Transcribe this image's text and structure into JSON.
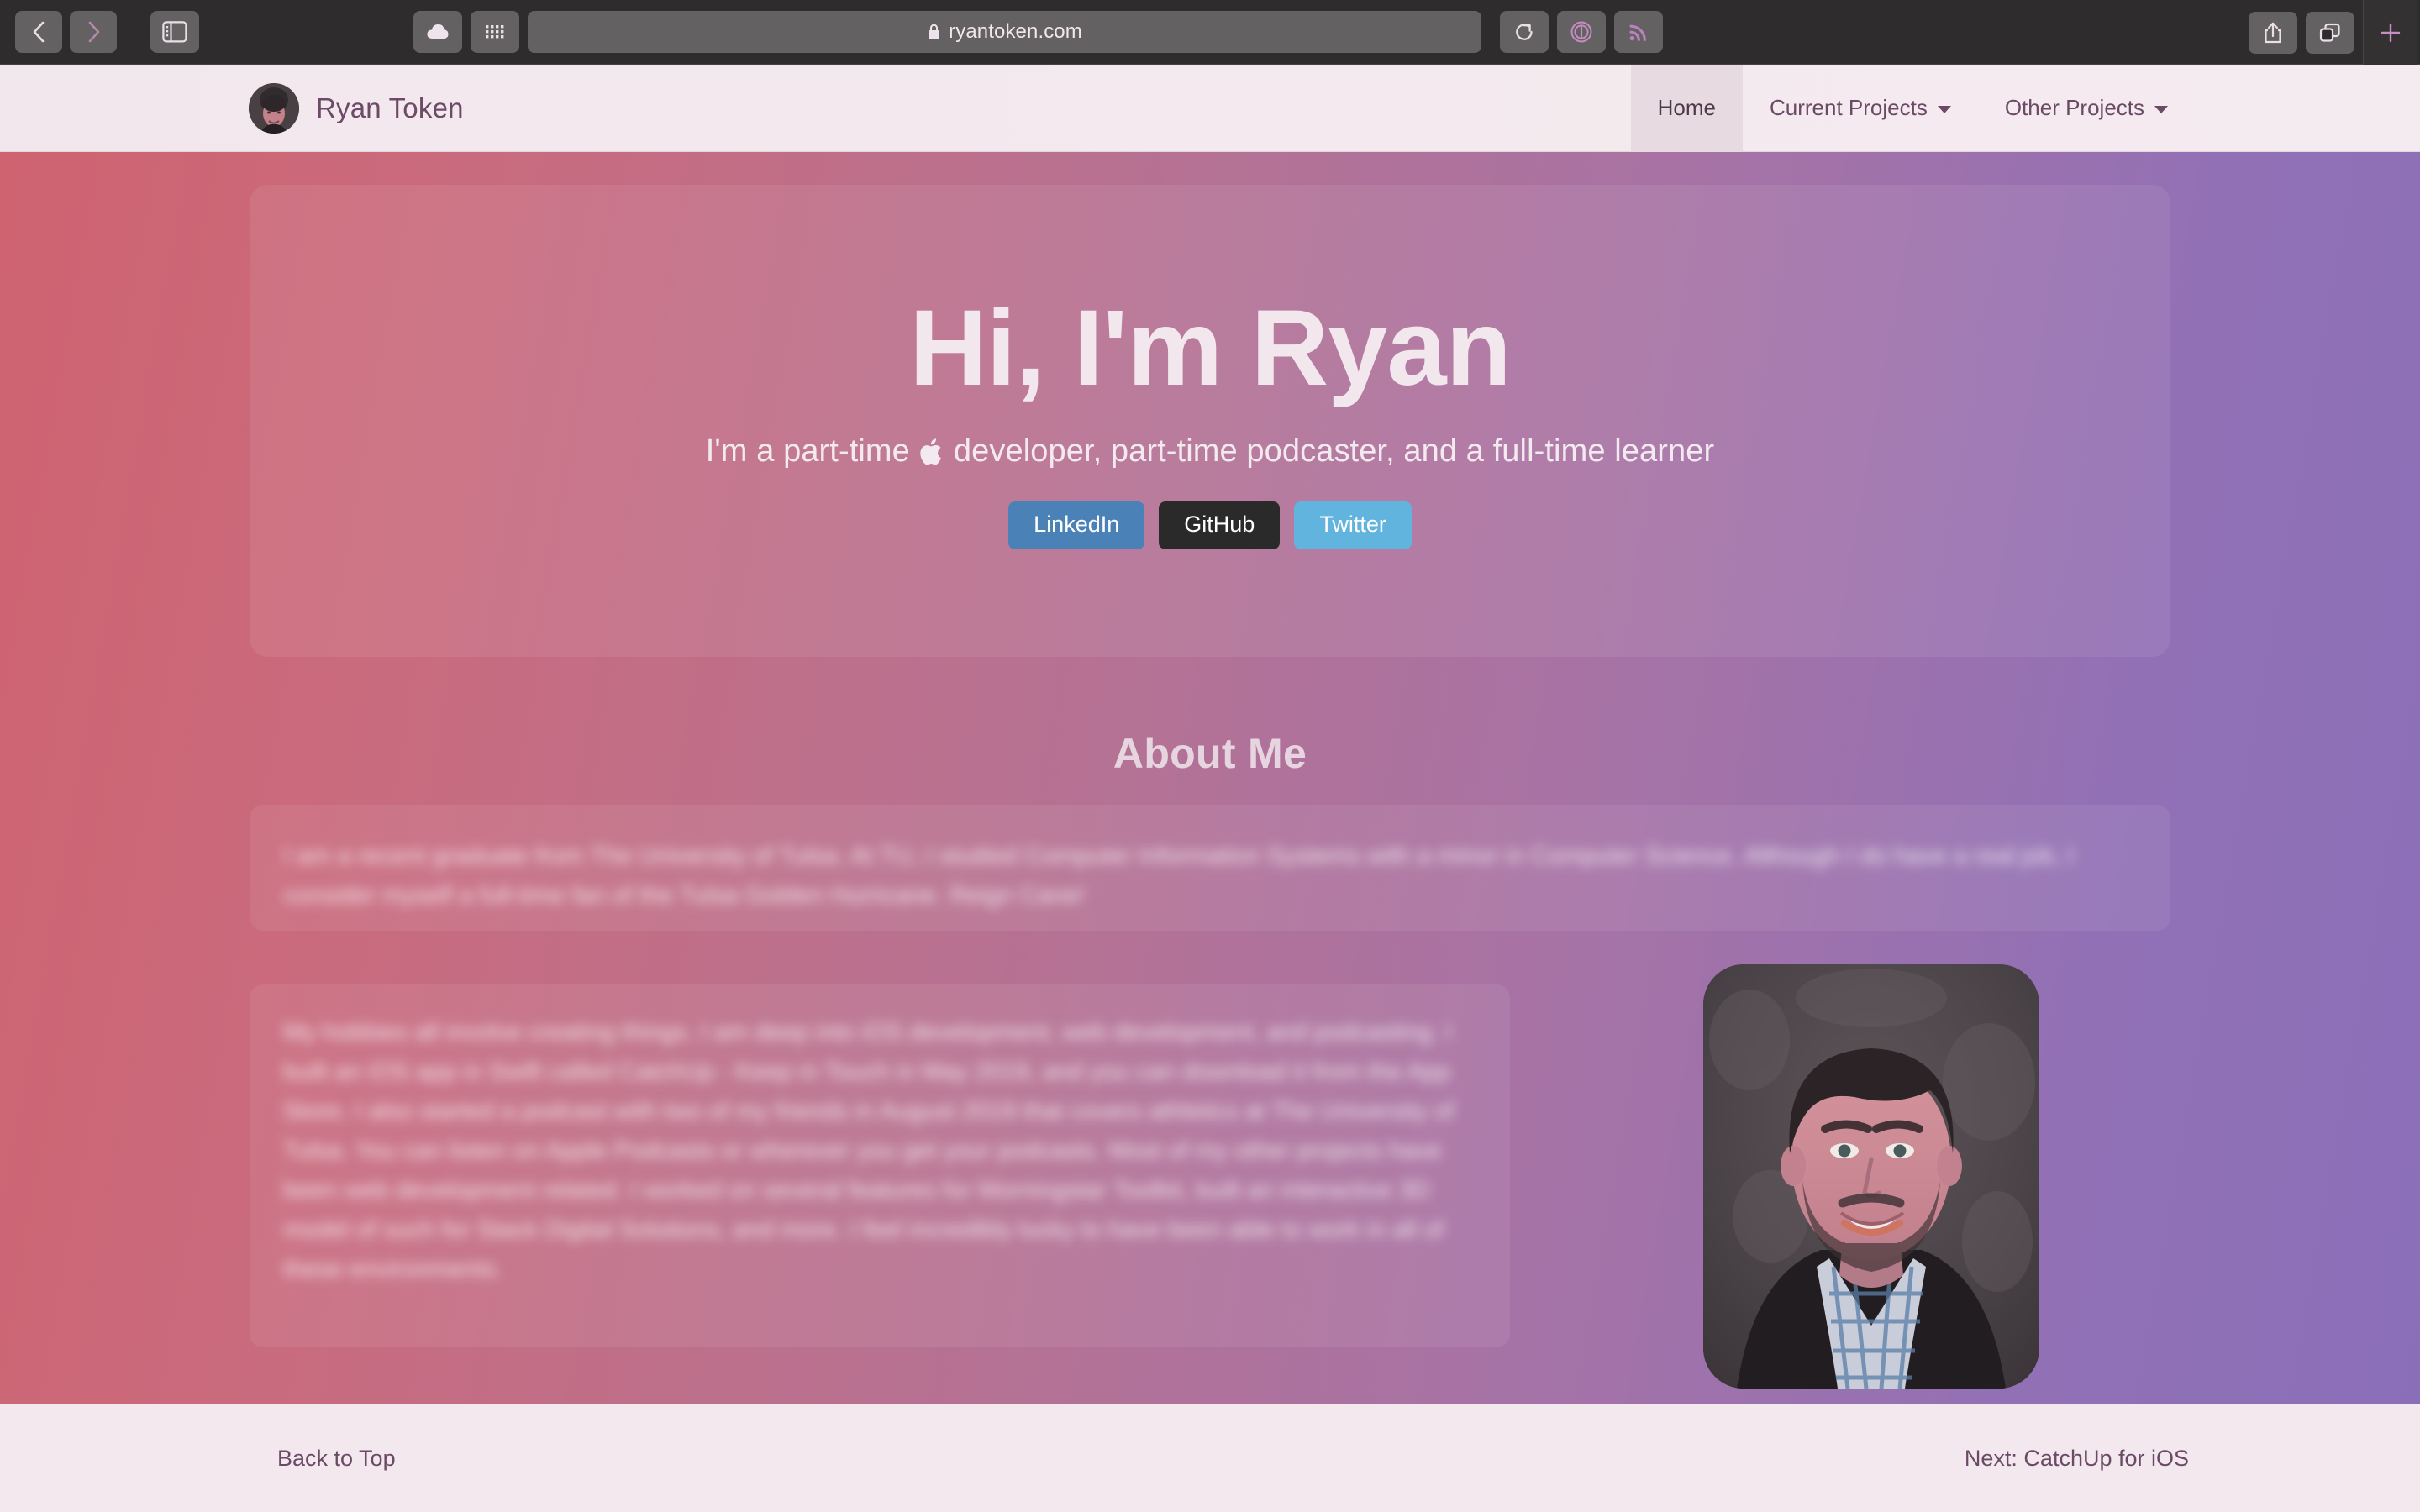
{
  "browser": {
    "url": "ryantoken.com",
    "lock_icon": "lock-icon",
    "back_icon": "chevron-left-icon",
    "forward_icon": "chevron-right-icon",
    "sidebar_icon": "sidebar-icon",
    "icloud_icon": "icloud-icon",
    "apps_grid_icon": "grid-icon",
    "reload_icon": "reload-icon",
    "reader_icon": "reader-mode-icon",
    "rss_icon": "rss-icon",
    "share_icon": "share-icon",
    "tabs_icon": "tab-overview-icon",
    "newtab_label": "+"
  },
  "nav": {
    "brand": "Ryan Token",
    "links": [
      {
        "label": "Home",
        "active": true,
        "dropdown": false
      },
      {
        "label": "Current Projects",
        "active": false,
        "dropdown": true
      },
      {
        "label": "Other Projects",
        "active": false,
        "dropdown": true
      }
    ]
  },
  "hero": {
    "title": "Hi, I'm Ryan",
    "subtitle_before": "I'm a part-time",
    "apple_glyph": "",
    "subtitle_after": "developer, part-time podcaster, and a full-time learner",
    "buttons": [
      {
        "label": "LinkedIn",
        "color": "#4a82b8"
      },
      {
        "label": "GitHub",
        "color": "#2b2a2a"
      },
      {
        "label": "Twitter",
        "color": "#61b4dd"
      }
    ]
  },
  "about": {
    "heading": "About Me",
    "paragraph1": "I am a recent graduate from The University of Tulsa. At TU, I studied Computer Information Systems with a minor in Computer Science. Although I do have a real job, I consider myself a full-time fan of the Tulsa Golden Hurricane. Reign Cane!",
    "paragraph2": "My hobbies all involve creating things. I am deep into iOS development, web development, and podcasting. I built an iOS app in Swift called CatchUp - Keep in Touch in May 2019, and you can download it from the App Store. I also started a podcast with two of my friends in August 2019 that covers athletics at The University of Tulsa. You can listen on Apple Podcasts or wherever you get your podcasts. Most of my other projects have been web development related. I worked on several features for Morningstar Toolkit, built an interactive 3D model of such for Stack Digital Solutions, and more. I feel incredibly lucky to have been able to work in all of these environments.",
    "portrait_alt": "portrait-photo"
  },
  "footer": {
    "back_to_top": "Back to Top",
    "next_link": "Next: CatchUp for iOS"
  },
  "colors": {
    "gradient_start": "#cf6370",
    "gradient_end": "#8a6fb8",
    "navbar_bg": "#f2e8ee",
    "nav_text": "#6b4a66",
    "hero_text": "#f3e7ee"
  }
}
